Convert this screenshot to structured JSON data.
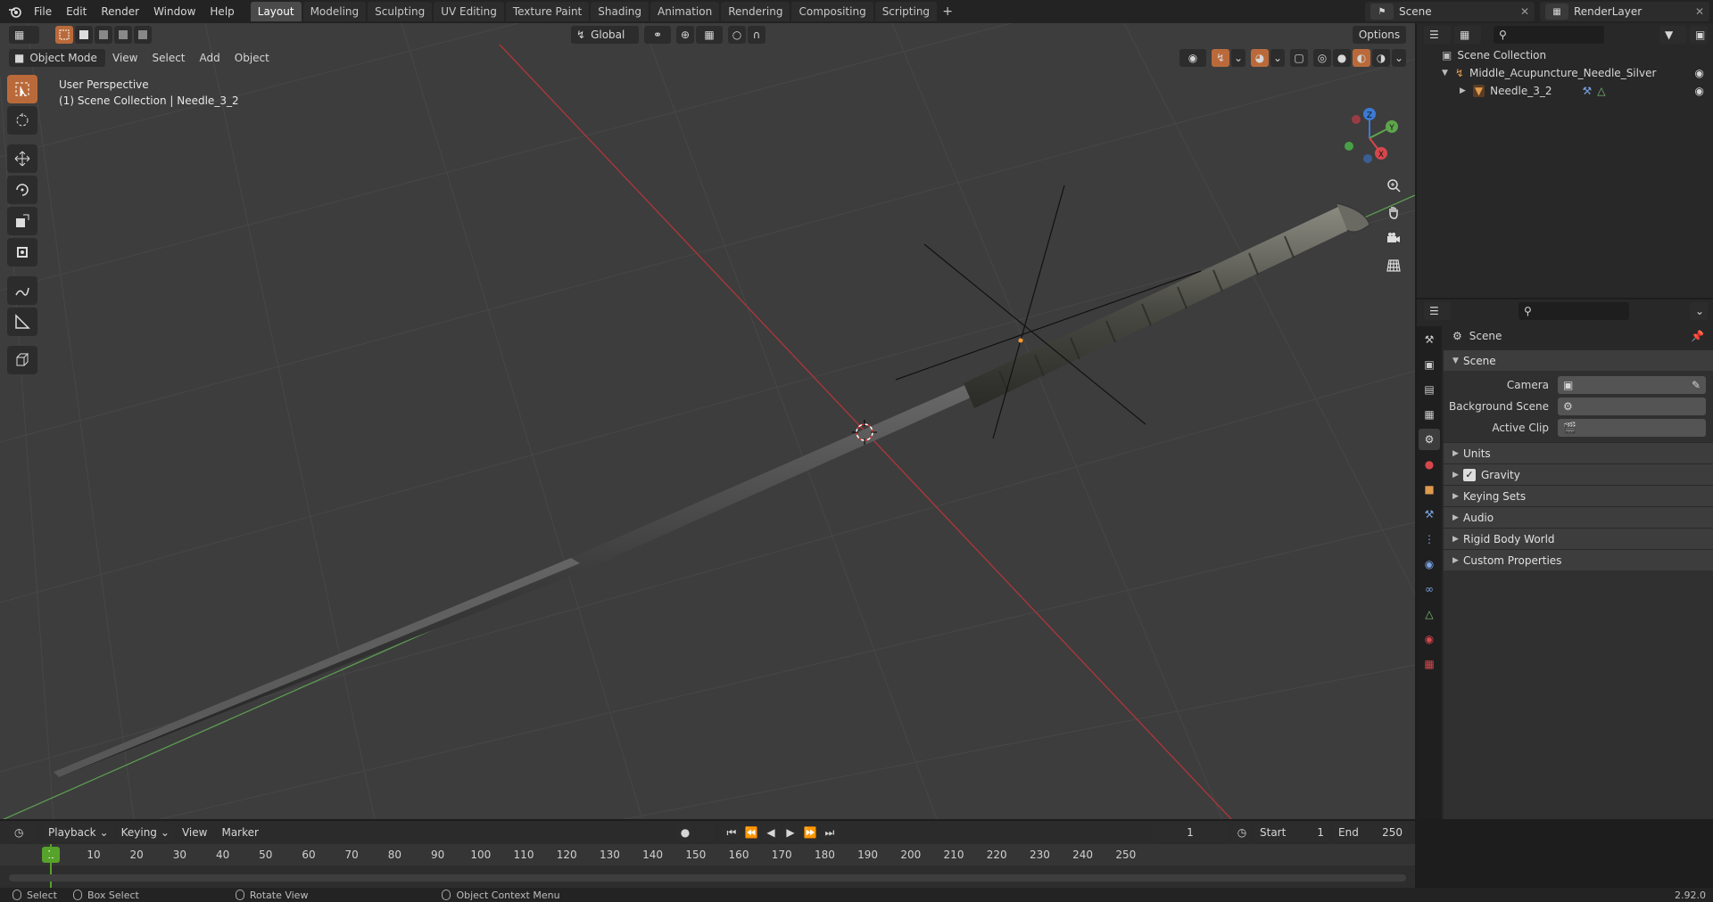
{
  "topbar": {
    "menus": [
      "File",
      "Edit",
      "Render",
      "Window",
      "Help"
    ],
    "workspaces": [
      "Layout",
      "Modeling",
      "Sculpting",
      "UV Editing",
      "Texture Paint",
      "Shading",
      "Animation",
      "Rendering",
      "Compositing",
      "Scripting"
    ],
    "active_workspace": "Layout",
    "add_tab": "+",
    "scene_name": "Scene",
    "view_layer": "RenderLayer"
  },
  "viewport": {
    "mode": "Object Mode",
    "menus": [
      "View",
      "Select",
      "Add",
      "Object"
    ],
    "transform_orientation": "Global",
    "options": "Options",
    "info_line1": "User Perspective",
    "info_line2": "(1) Scene Collection | Needle_3_2",
    "gizmo_axes": {
      "x": "X",
      "y": "Y",
      "z": "Z"
    }
  },
  "toolbar": {
    "tools": [
      "select-box",
      "cursor",
      "move",
      "rotate",
      "scale",
      "transform",
      "annotate",
      "measure",
      "add-cube"
    ]
  },
  "outliner": {
    "root": "Scene Collection",
    "items": [
      {
        "label": "Middle_Acupuncture_Needle_Silver",
        "level": 1,
        "icon": "empty-icon"
      },
      {
        "label": "Needle_3_2",
        "level": 2,
        "icon": "mesh-icon"
      }
    ]
  },
  "properties": {
    "context": "Scene",
    "panels": {
      "scene": {
        "title": "Scene",
        "camera_label": "Camera",
        "background_scene_label": "Background Scene",
        "active_clip_label": "Active Clip"
      },
      "collapsed": [
        "Units",
        "Gravity",
        "Keying Sets",
        "Audio",
        "Rigid Body World",
        "Custom Properties"
      ],
      "gravity_checked": true
    }
  },
  "timeline": {
    "menus": [
      "Playback",
      "Keying",
      "View",
      "Marker"
    ],
    "current_frame": "1",
    "start_label": "Start",
    "start": "1",
    "end_label": "End",
    "end": "250",
    "ticks": [
      "10",
      "20",
      "30",
      "40",
      "50",
      "60",
      "70",
      "80",
      "90",
      "100",
      "110",
      "120",
      "130",
      "140",
      "150",
      "160",
      "170",
      "180",
      "190",
      "200",
      "210",
      "220",
      "230",
      "240",
      "250"
    ]
  },
  "statusbar": {
    "select": "Select",
    "box_select": "Box Select",
    "rotate_view": "Rotate View",
    "context_menu": "Object Context Menu",
    "version": "2.92.0"
  }
}
